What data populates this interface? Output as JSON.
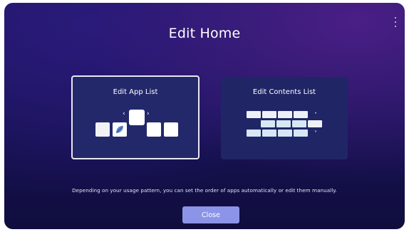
{
  "screen": {
    "title": "Edit Home",
    "menu_icon": "more-vertical-icon"
  },
  "cards": {
    "app_list": {
      "label": "Edit App List",
      "selected": true,
      "illustration_icons": [
        "chevron-left-icon",
        "chevron-right-icon",
        "app-tile-icon",
        "leaf-app-icon"
      ]
    },
    "contents_list": {
      "label": "Edit Contents List",
      "selected": false,
      "illustration_icons": [
        "content-grid-icon",
        "chevron-up-icon",
        "chevron-down-icon"
      ]
    }
  },
  "description": "Depending on your usage pattern, you can set the order of apps automatically or edit them manually.",
  "close_button": {
    "label": "Close"
  },
  "colors": {
    "background_top": "#1d1663",
    "background_bottom": "#100d3e",
    "card": "#22286a",
    "selected_border": "#e8e8f0",
    "button": "#8c94e8"
  }
}
